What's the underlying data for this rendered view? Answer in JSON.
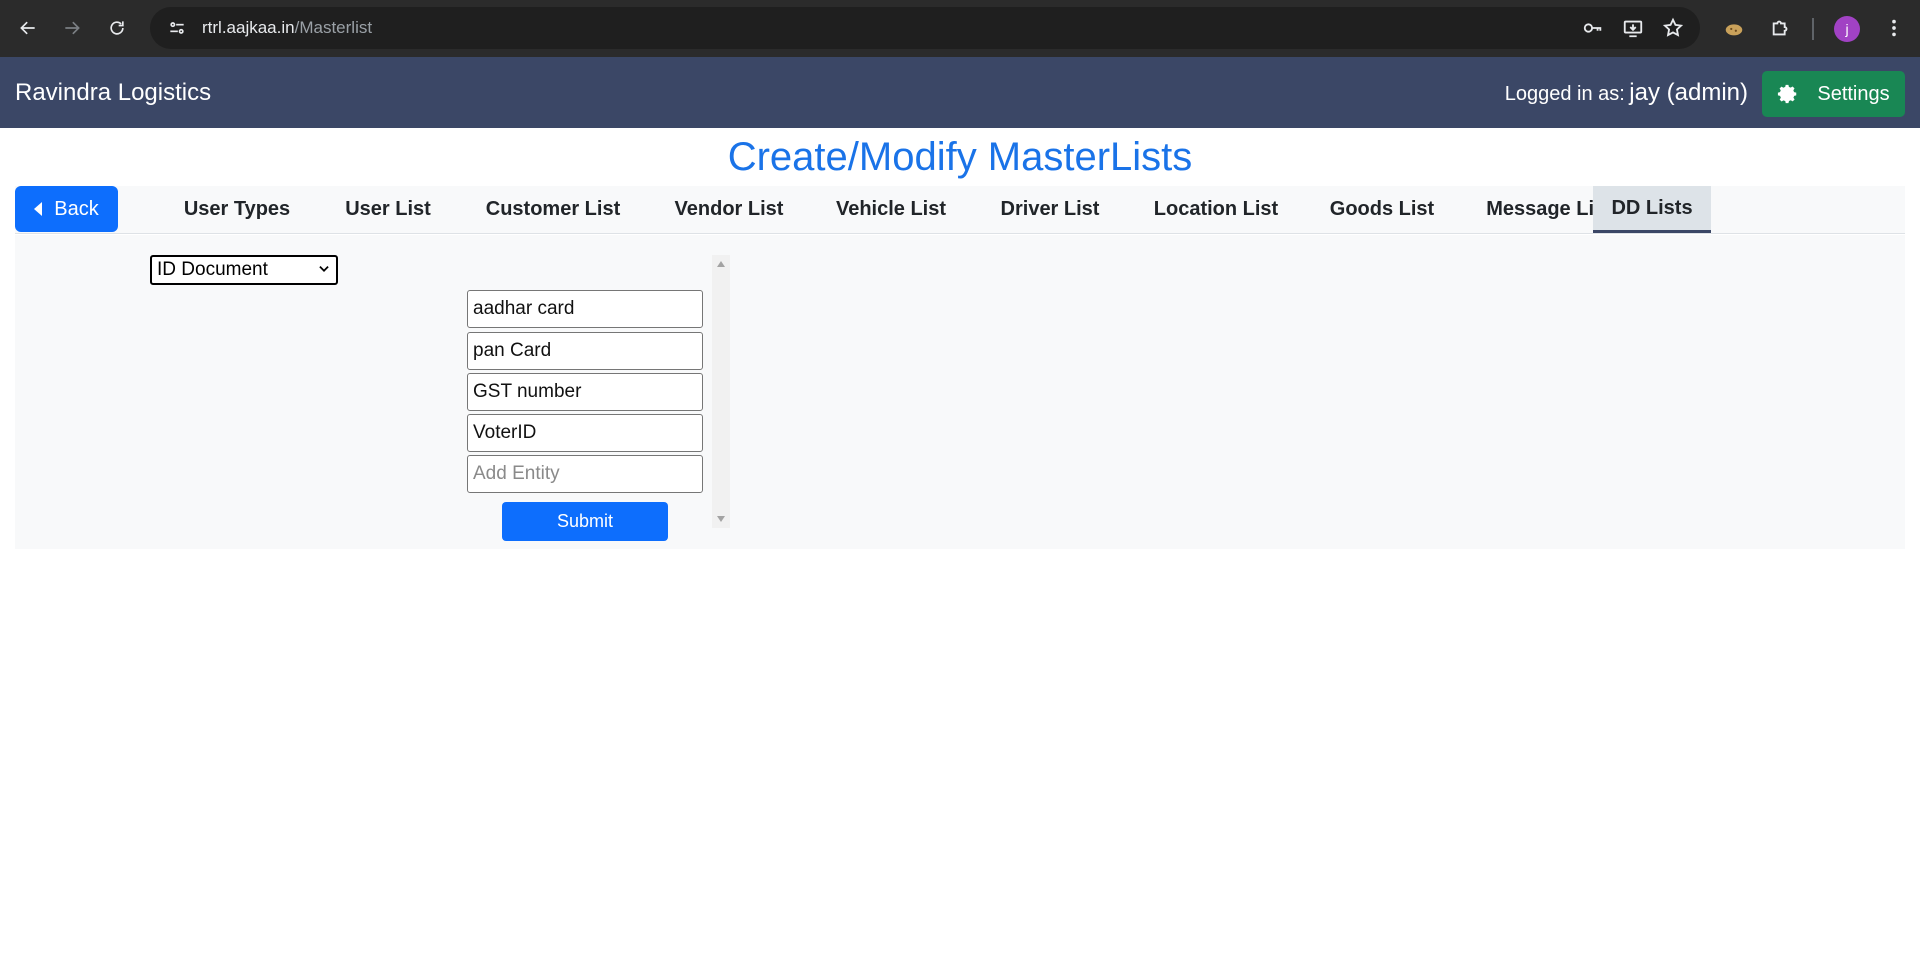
{
  "browser": {
    "url_domain": "rtrl.aajkaa.in",
    "url_path": "/Masterlist",
    "profile_initial": "j"
  },
  "header": {
    "brand": "Ravindra Logistics",
    "logged_in_label": "Logged in as:",
    "user": "jay (admin)",
    "settings_label": "Settings",
    "colors": {
      "bar": "#3b4766",
      "settings": "#198754"
    }
  },
  "page": {
    "title": "Create/Modify MasterLists"
  },
  "tabs": {
    "back_label": "Back",
    "items": [
      {
        "label": "User Types"
      },
      {
        "label": "User List"
      },
      {
        "label": "Customer List"
      },
      {
        "label": "Vendor List"
      },
      {
        "label": "Vehicle List"
      },
      {
        "label": "Driver List"
      },
      {
        "label": "Location List"
      },
      {
        "label": "Goods List"
      },
      {
        "label": "Message List"
      },
      {
        "label": "DD Lists",
        "active": true
      }
    ]
  },
  "dd_lists": {
    "selected_list": "ID Document",
    "entities": [
      {
        "value": "aadhar card"
      },
      {
        "value": "pan Card"
      },
      {
        "value": "GST number"
      },
      {
        "value": "VoterID"
      }
    ],
    "add_placeholder": "Add Entity",
    "submit_label": "Submit"
  }
}
